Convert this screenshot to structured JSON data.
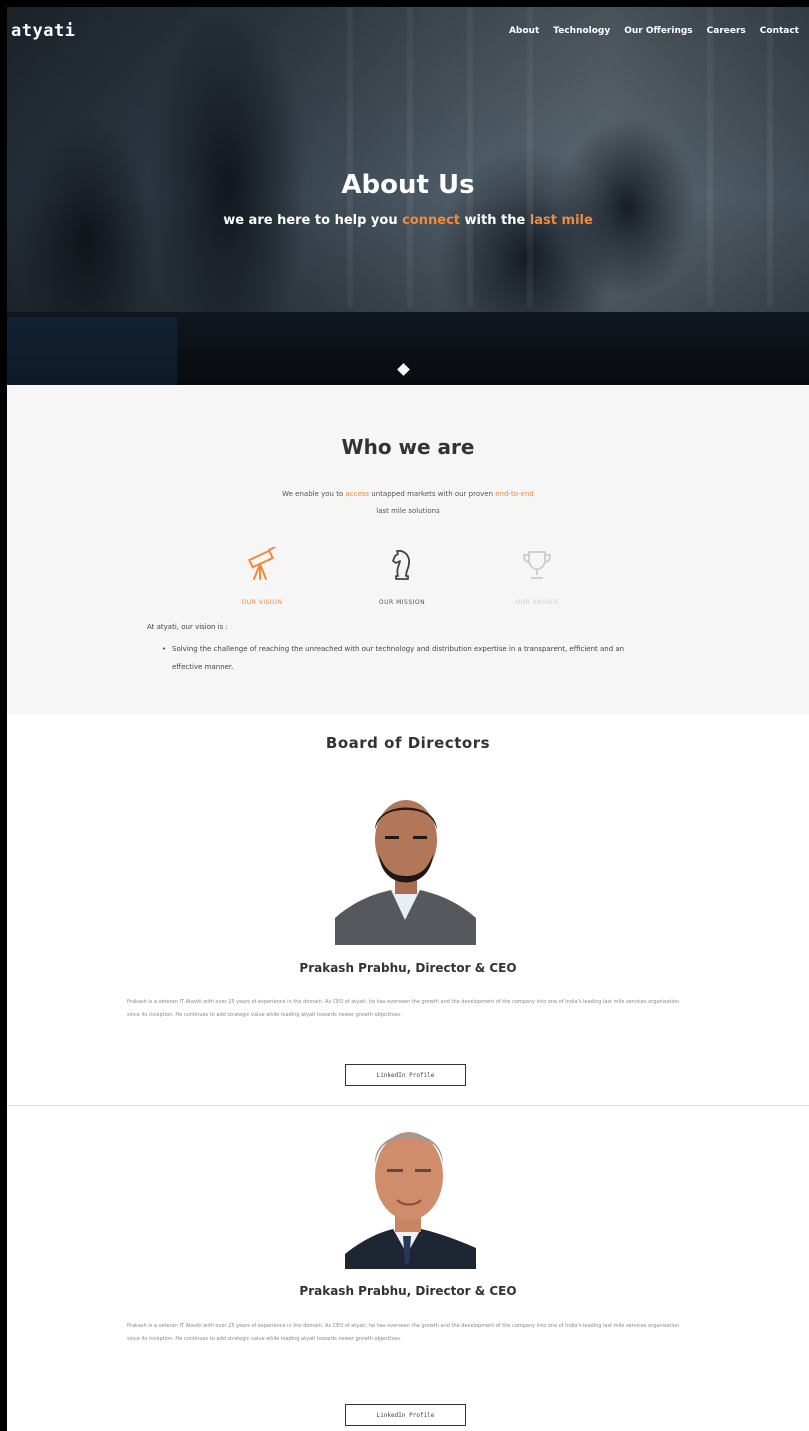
{
  "header": {
    "logo": "atyati",
    "nav": [
      "About",
      "Technology",
      "Our Offerings",
      "Careers",
      "Contact"
    ]
  },
  "hero": {
    "title": "About Us",
    "subtitle_pre": "we are here to help you ",
    "subtitle_hl1": "connect",
    "subtitle_mid": " with the ",
    "subtitle_hl2": "last mile"
  },
  "who": {
    "title": "Who we are",
    "line1_pre": "We enable you to ",
    "line1_hl1": "access",
    "line1_mid": " untapped markets with our proven ",
    "line1_hl2": "end-to-end",
    "line2": "last mile solutions",
    "tabs": [
      "OUR VISION",
      "OUR MISSION",
      "OUR VALUES"
    ],
    "vision_intro": "At atyati, our vision is :",
    "vision_items": [
      "Solving the challenge of reaching the unreached with our technology and distribution expertise in a transparent, efficient and an effective manner."
    ]
  },
  "board": {
    "title": "Board of Directors",
    "directors": [
      {
        "name": "Prakash Prabhu, Director & CEO",
        "bio": "Prakash is a veteran IT Ataviti with over 25 years of experience in the domain. As CEO of atyati, he has overseen the growth and the development of the company into one of India's leading last mile services organisation since its inception. He continues to add strategic value while leading atyati towards newer growth objectives.",
        "button": "LinkedIn Profile"
      },
      {
        "name": "Prakash Prabhu, Director & CEO",
        "bio": "Prakash is a veteran IT Ataviti with over 25 years of experience in the domain. As CEO of atyati, he has overseen the growth and the development of the company into one of India's leading last mile services organisation since its inception. He continues to add strategic value while leading atyati towards newer growth objectives.",
        "button": "LinkedIn Profile"
      }
    ]
  },
  "colors": {
    "accent": "#f08a3c",
    "text": "#333333",
    "muted": "#888888"
  }
}
